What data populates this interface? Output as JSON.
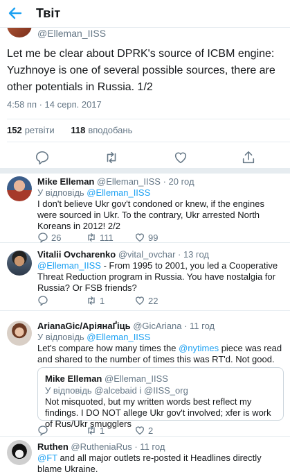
{
  "header": {
    "title": "Твіт"
  },
  "main_tweet": {
    "handle": "@Elleman_IISS",
    "text": "Let me be clear about DPRK's source of ICBM engine:  Yuzhnoye is one of several possible sources, there are other potentials in Russia. 1/2",
    "time": "4:58 пп · 14 серп. 2017",
    "retweets": "152",
    "retweets_label": "ретвіти",
    "likes": "118",
    "likes_label": "вподобань"
  },
  "replies": [
    {
      "name": "Mike Elleman",
      "handle": "@Elleman_IISS · 20 год",
      "in_reply_prefix": "У відповідь ",
      "in_reply_to": "@Elleman_IISS",
      "body_pre": "",
      "body_link": "",
      "body": "I don't believe Ukr gov't condoned or knew, if the engines were sourced in Ukr. To the contrary, Ukr arrested North Koreans in 2012! 2/2",
      "reply_count": "26",
      "retweet_count": "111",
      "like_count": "99"
    },
    {
      "name": "Vitalii Ovcharenko",
      "handle": "@vital_ovchar · 13 год",
      "body_link": "@Elleman_IISS",
      "body": " - From 1995 to 2001, you led a Cooperative Threat Reduction program in Russia. You have nostalgia for Russia? Or FSB friends?",
      "reply_count": "",
      "retweet_count": "1",
      "like_count": "22"
    },
    {
      "name": "ArianaGic/АріянаҐіць",
      "handle": "@GicAriana · 11 год",
      "in_reply_prefix": "У відповідь ",
      "in_reply_to": "@Elleman_IISS",
      "body_a": "Let's compare how many times the ",
      "body_link": "@nytimes",
      "body_b": "  piece was read and shared to the number of times this was RT'd. Not good.",
      "quote": {
        "name": "Mike Elleman",
        "handle": "@Elleman_IISS",
        "in_reply": "У відповідь @alcebaid і @IISS_org",
        "body": "Not misquoted, but my written words best reflect my findings. I DO NOT allege Ukr gov't involved; xfer is work of Rus/Ukr smugglers"
      },
      "reply_count": "",
      "retweet_count": "1",
      "like_count": "2"
    },
    {
      "name": "Ruthen",
      "handle": "@RutheniaRus · 11 год",
      "body_link": "@FT",
      "body": " and all major outlets re-posted it  Headlines directly blame Ukraine."
    }
  ],
  "icons": [
    "back-arrow-icon",
    "reply-icon",
    "retweet-icon",
    "like-icon",
    "share-icon"
  ],
  "colors": {
    "accent": "#1da1f2",
    "muted": "#657786",
    "text": "#14171a",
    "divider": "#e6ecf0"
  }
}
